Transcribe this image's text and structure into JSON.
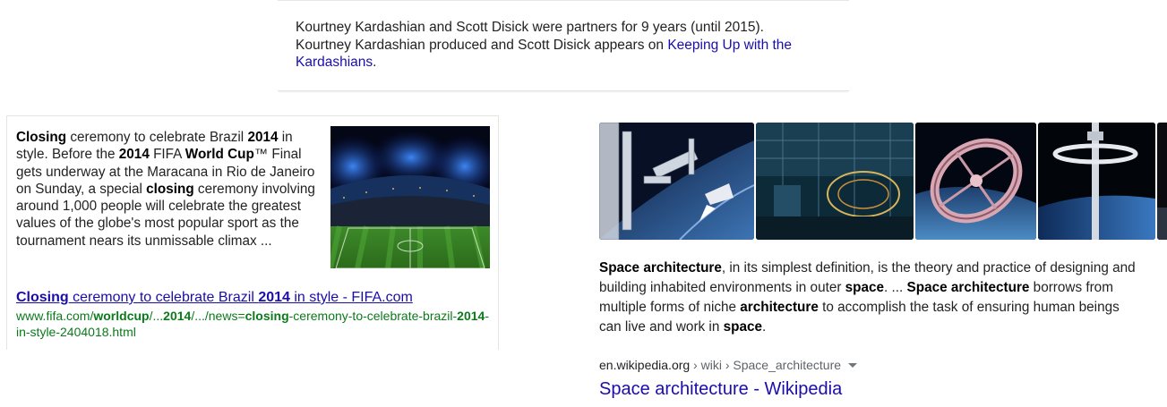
{
  "top_panel": {
    "line1": "Kourtney Kardashian and Scott Disick were partners for 9 years (until 2015).",
    "line2_prefix": "Kourtney Kardashian produced and Scott Disick appears on ",
    "show_link": "Keeping Up with the Kardashians",
    "line2_suffix": "."
  },
  "fifa": {
    "snippet": [
      {
        "t": "Closing",
        "b": true
      },
      {
        "t": " ceremony to celebrate Brazil ",
        "b": false
      },
      {
        "t": "2014",
        "b": true
      },
      {
        "t": " in style. Before the ",
        "b": false
      },
      {
        "t": "2014",
        "b": true
      },
      {
        "t": " FIFA ",
        "b": false
      },
      {
        "t": "World Cup",
        "b": true
      },
      {
        "t": "™ Final gets underway at the Maracana in Rio de Janeiro on Sunday, a special ",
        "b": false
      },
      {
        "t": "closing",
        "b": true
      },
      {
        "t": " ceremony involving around 1,000 people will celebrate the greatest values of the globe's most popular sport as the tournament nears its unmissable climax ...",
        "b": false
      }
    ],
    "title_parts": [
      {
        "t": "Closing",
        "b": true
      },
      {
        "t": " ceremony to celebrate Brazil ",
        "b": false
      },
      {
        "t": "2014",
        "b": true
      },
      {
        "t": " in style - FIFA.com",
        "b": false
      }
    ],
    "url_parts": [
      {
        "t": "www.fifa.com/",
        "b": false
      },
      {
        "t": "worldcup",
        "b": true
      },
      {
        "t": "/...",
        "b": false
      },
      {
        "t": "2014",
        "b": true
      },
      {
        "t": "/.../news=",
        "b": false
      },
      {
        "t": "closing",
        "b": true
      },
      {
        "t": "-ceremony-to-celebrate-brazil-",
        "b": false
      },
      {
        "t": "2014",
        "b": true
      },
      {
        "t": "-in-style-2404018.html",
        "b": false
      }
    ]
  },
  "wiki": {
    "snippet": [
      {
        "t": "Space architecture",
        "b": true
      },
      {
        "t": ", in its simplest definition, is the theory and practice of designing and building inhabited environments in outer ",
        "b": false
      },
      {
        "t": "space",
        "b": true
      },
      {
        "t": ". ... ",
        "b": false
      },
      {
        "t": "Space architecture",
        "b": true
      },
      {
        "t": " borrows from multiple forms of niche ",
        "b": false
      },
      {
        "t": "architecture",
        "b": true
      },
      {
        "t": " to accomplish the task of ensuring human beings can live and work in ",
        "b": false
      },
      {
        "t": "space",
        "b": true
      },
      {
        "t": ".",
        "b": false
      }
    ],
    "cite_domain": "en.wikipedia.org",
    "cite_path": " › wiki › Space_architecture",
    "title": "Space architecture - Wikipedia",
    "thumbnail_count": 5
  },
  "colors": {
    "link": "#1a0dab",
    "url_green": "#0a7a1a",
    "text": "#222222"
  }
}
